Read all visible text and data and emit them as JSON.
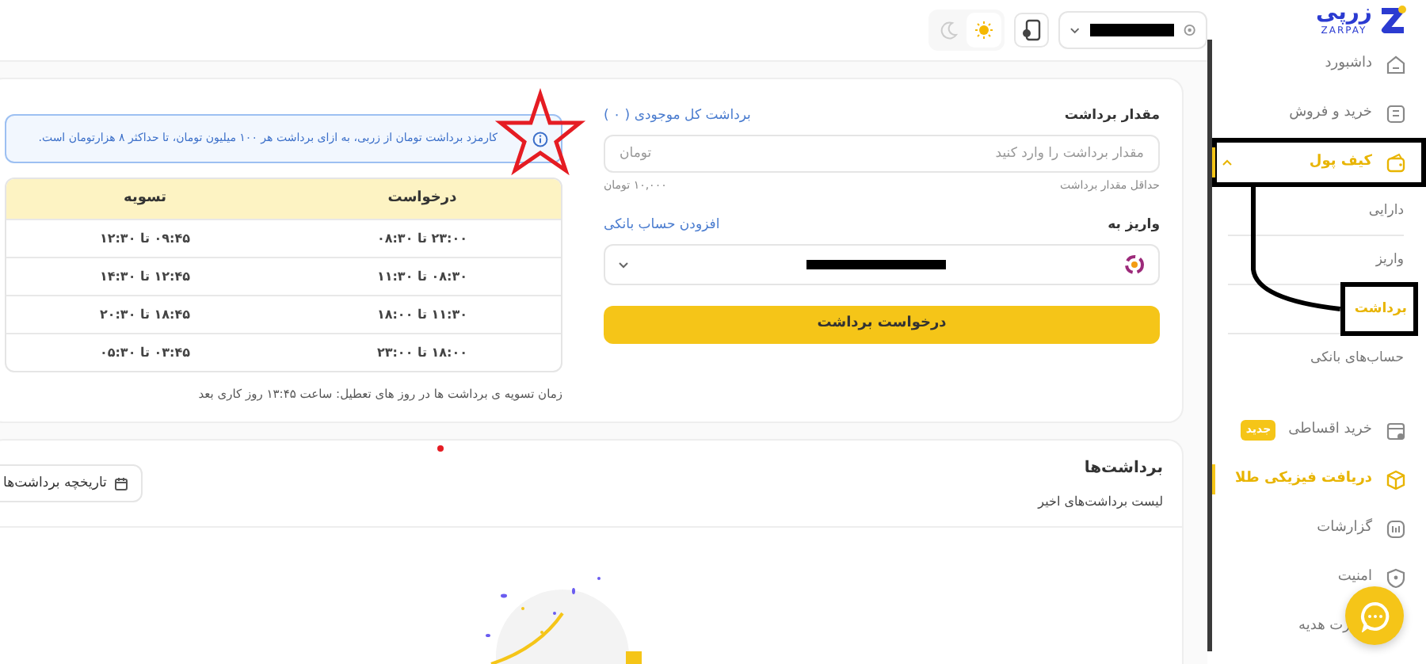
{
  "header": {
    "theme_toggle": [
      {
        "kind": "dark",
        "selected": false
      },
      {
        "kind": "light",
        "selected": true
      }
    ]
  },
  "logo": {
    "text": "زرپی",
    "subtitle": "ZARPAY"
  },
  "sidebar": {
    "items": [
      {
        "kind": "item",
        "label": "داشبورد",
        "selected": false
      },
      {
        "kind": "item",
        "label": "خرید و فروش",
        "selected": false
      },
      {
        "kind": "group",
        "label": "کیف پول",
        "selected": true,
        "expanded": true,
        "children": [
          {
            "label": "دارایی",
            "selected": false
          },
          {
            "label": "واریز",
            "selected": false
          },
          {
            "label": "برداشت",
            "selected": true
          },
          {
            "label": "حساب‌های بانکی",
            "selected": false
          }
        ]
      },
      {
        "kind": "item",
        "label": "خرید اقساطی",
        "badge": "جدید",
        "selected": false
      },
      {
        "kind": "item",
        "label": "دریافت فیزیکی طلا",
        "selected": true
      },
      {
        "kind": "item",
        "label": "گزارشات",
        "selected": false
      },
      {
        "kind": "item",
        "label": "امنیت",
        "selected": false
      },
      {
        "kind": "item",
        "label": "رت هدیه",
        "selected": false
      }
    ]
  },
  "withdraw_form": {
    "amount_label": "مقدار برداشت",
    "withdraw_all_link": "برداشت کل موجودی ( ۰ )",
    "amount_field": {
      "placeholder": "مقدار برداشت را وارد کنید",
      "unit": "تومان"
    },
    "min_label": "حداقل مقدار برداشت",
    "min_value": "۱۰,۰۰۰ تومان",
    "destination_label": "واریز به",
    "add_bank_link": "افزودن حساب بانکی",
    "submit_button": "درخواست برداشت"
  },
  "fee_notice": "کارمزد برداشت تومان از زربی، به ازای برداشت هر ۱۰۰ میلیون تومان، تا حداکثر ۸ هزارتومان است.",
  "schedule_table": {
    "columns": [
      "درخواست",
      "تسویه"
    ],
    "rows": [
      [
        "۲۳:۰۰ تا ۰۸:۳۰",
        "۰۹:۴۵ تا ۱۲:۳۰"
      ],
      [
        "۰۸:۳۰ تا ۱۱:۳۰",
        "۱۲:۴۵ تا ۱۴:۳۰"
      ],
      [
        "۱۱:۳۰ تا ۱۸:۰۰",
        "۱۸:۴۵ تا ۲۰:۳۰"
      ],
      [
        "۱۸:۰۰ تا ۲۳:۰۰",
        "۰۳:۴۵ تا ۰۵:۳۰"
      ]
    ]
  },
  "holiday_note": "زمان تسویه ی برداشت ها در روز های تعطیل: ساعت ۱۳:۴۵ روز کاری بعد",
  "withdrawals": {
    "title": "برداشت‌ها",
    "subtitle": "لیست برداشت‌های اخیر",
    "history_button": "تاریخچه برداشت‌ها"
  }
}
